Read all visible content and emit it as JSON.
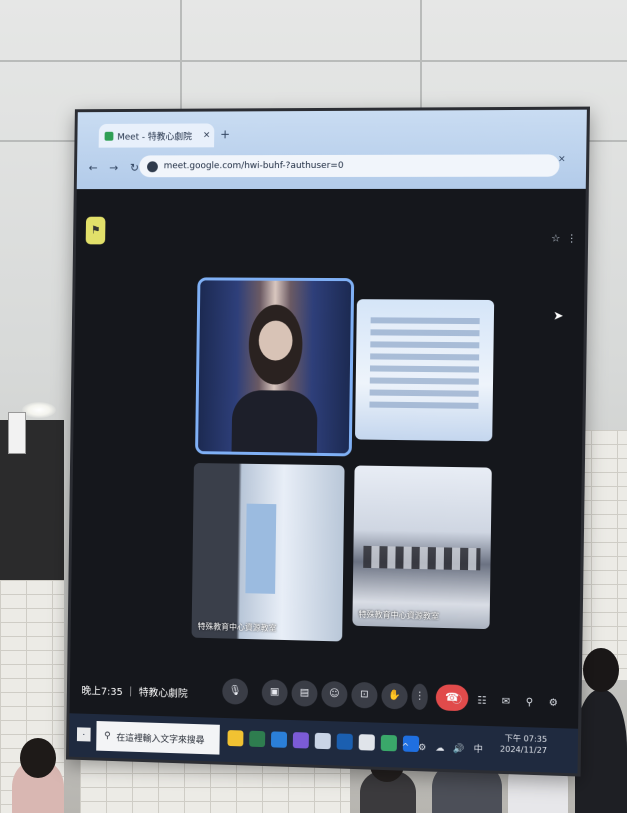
{
  "browser": {
    "tab_title": "Meet - 特教心劇院",
    "tab_close": "×",
    "new_tab": "+",
    "url": "meet.google.com/hwi-buhf-?authuser=0",
    "window_controls": "– ▢ ×"
  },
  "meet": {
    "tiles": [
      {
        "name": ""
      },
      {
        "name": ""
      },
      {
        "name": "特殊教育中心資源教室"
      },
      {
        "name": "特殊教育中心資源教室"
      }
    ],
    "clock": "晚上7:35 ｜ 特教心劇院"
  },
  "taskbar": {
    "search_placeholder": "在這裡輸入文字來搜尋",
    "time": "下午 07:35",
    "date": "2024/11/27"
  },
  "colors": {
    "accent": "#7fb0f5",
    "hangup": "#e14b4b",
    "taskbar": "#1f2a3f"
  }
}
